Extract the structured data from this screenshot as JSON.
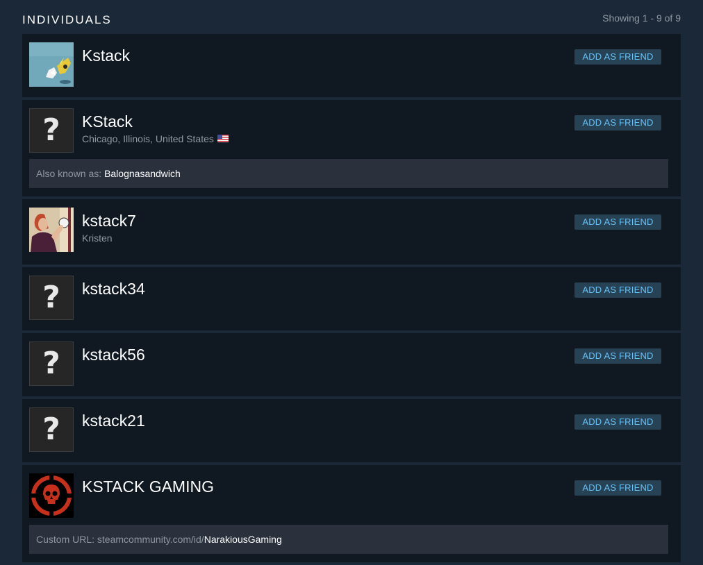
{
  "section": {
    "title": "INDIVIDUALS",
    "showing": "Showing 1 - 9 of 9"
  },
  "add_label": "ADD AS FRIEND",
  "results": [
    {
      "name": "Kstack"
    },
    {
      "name": "KStack",
      "location": "Chicago, Illinois, United States",
      "extra_label": "Also known as: ",
      "extra_value": "Balognasandwich"
    },
    {
      "name": "kstack7",
      "real_name": "Kristen"
    },
    {
      "name": "kstack34"
    },
    {
      "name": "kstack56"
    },
    {
      "name": "kstack21"
    },
    {
      "name": "KSTACK GAMING",
      "extra_label": "Custom URL: steamcommunity.com/id/",
      "extra_value": "NarakiousGaming"
    }
  ],
  "colors": {
    "page_bg": "#1b2838",
    "row_bg": "#101822",
    "button_bg": "#274155",
    "button_text": "#67c1f5",
    "extra_bg": "#2a313d"
  }
}
